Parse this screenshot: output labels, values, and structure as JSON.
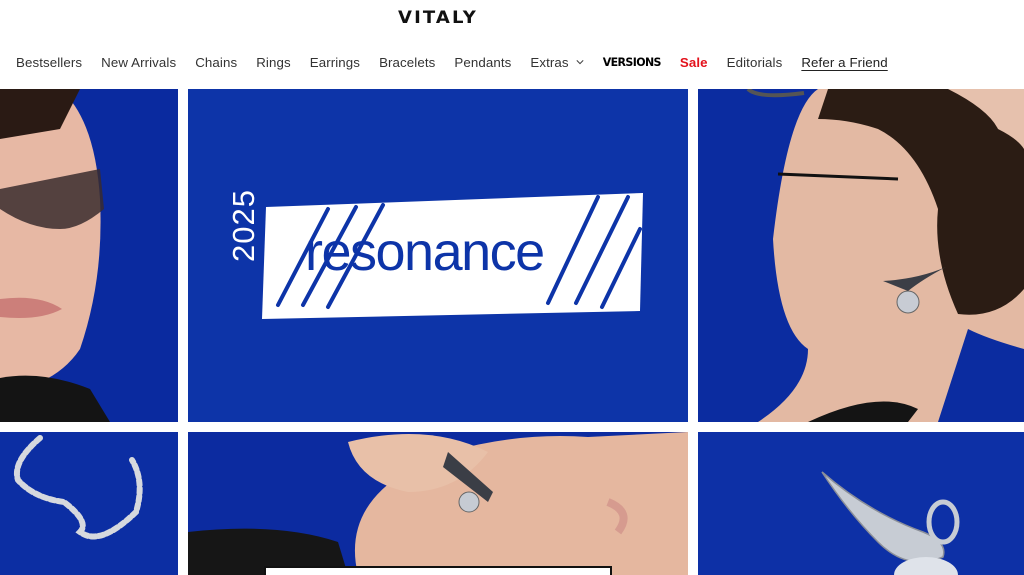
{
  "brand": {
    "logo": "VITALY"
  },
  "nav": {
    "items": [
      {
        "label": "Bestsellers"
      },
      {
        "label": "New Arrivals"
      },
      {
        "label": "Chains"
      },
      {
        "label": "Rings"
      },
      {
        "label": "Earrings"
      },
      {
        "label": "Bracelets"
      },
      {
        "label": "Pendants"
      }
    ],
    "extras": "Extras",
    "versions": "VERSIONS",
    "sale": "Sale",
    "editorials": "Editorials",
    "refer": "Refer a Friend"
  },
  "hero": {
    "year": "2025",
    "word": "resonance"
  },
  "colors": {
    "brand_blue": "#0d34a8",
    "sale_red": "#e3111b",
    "text": "#222222"
  }
}
